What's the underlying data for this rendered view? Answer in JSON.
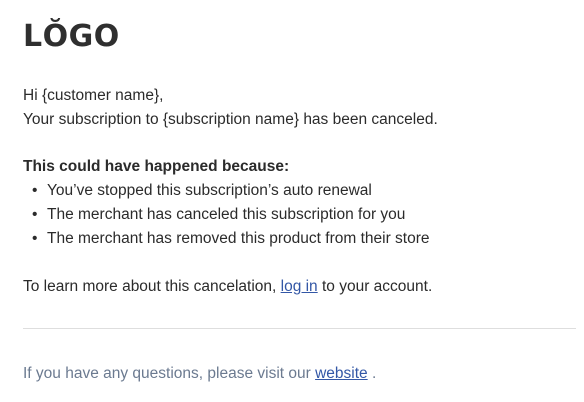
{
  "logo": {
    "text": "LŎGO"
  },
  "greeting": {
    "line1": "Hi {customer name},",
    "line2": "Your subscription to {subscription name} has been canceled."
  },
  "reasons": {
    "heading": "This could have happened because:",
    "items": [
      "You’ve stopped this subscription’s auto renewal",
      "The merchant has canceled this subscription for you",
      "The merchant has removed this product from their store"
    ]
  },
  "learn_more": {
    "before": "To learn more about this cancelation, ",
    "link_label": "log in",
    "after": " to your account."
  },
  "footer": {
    "before": "If you have any questions, please visit our ",
    "link_label": "website",
    "after": " ."
  },
  "colors": {
    "text": "#2b2b2b",
    "link": "#3357a6",
    "footer_text": "#6b7a90",
    "divider": "#dedede"
  }
}
